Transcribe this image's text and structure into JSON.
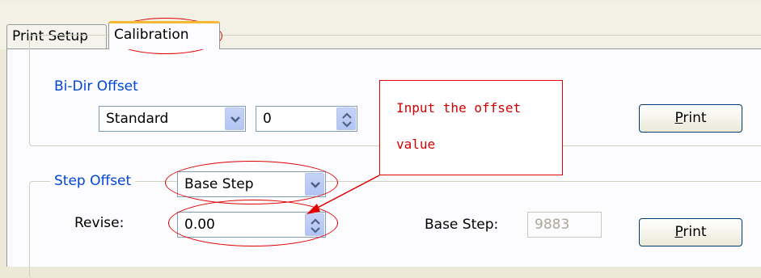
{
  "tabs": [
    {
      "label": "Print Setup"
    },
    {
      "label": "Calibration"
    }
  ],
  "bidir": {
    "legend": "Bi-Dir Offset",
    "mode_value": "Standard",
    "offset_value": "0",
    "print_label_first": "P",
    "print_label_rest": "rint"
  },
  "step": {
    "legend": "Step Offset",
    "mode_value": "Base Step",
    "revise_label": "Revise:",
    "revise_value": "0.00",
    "base_step_label": "Base Step:",
    "base_step_value": "9883",
    "print_label_first": "P",
    "print_label_rest": "rint"
  },
  "annotation": {
    "line1": "Input the offset",
    "line2": "value",
    "color": "#e00000"
  },
  "colors": {
    "accent_tab": "#f9b934",
    "group_legend": "#0046d5",
    "window_bg": "#ece9d8"
  }
}
